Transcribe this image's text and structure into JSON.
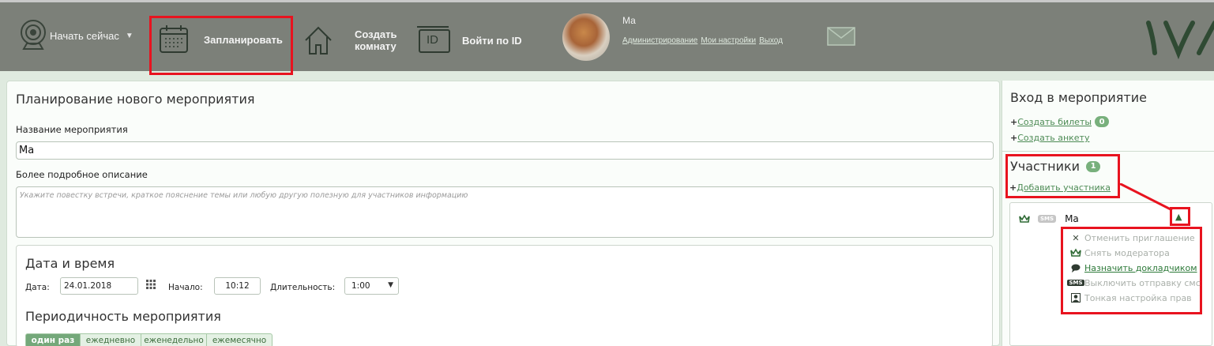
{
  "topbar": {
    "start_now": "Начать сейчас",
    "schedule": "Запланировать",
    "create_room_line1": "Создать",
    "create_room_line2": "комнату",
    "id_icon_text": "ID",
    "login_by_id": "Войти по ID",
    "user_name": "Ма",
    "links": [
      "Администрирование",
      "Мои настройки",
      "Выход"
    ],
    "logo": "IVA"
  },
  "main": {
    "title": "Планирование нового мероприятия",
    "name_label": "Название мероприятия",
    "name_value": "Ма",
    "desc_label": "Более подробное описание",
    "desc_placeholder": "Укажите повестку встречи, краткое пояснение темы или любую другую полезную для участников информацию",
    "datetime_title": "Дата и время",
    "date_label": "Дата:",
    "date_value": "24.01.2018",
    "start_label": "Начало:",
    "start_value": "10:12",
    "duration_label": "Длительность:",
    "duration_value": "1:00",
    "period_title": "Периодичность мероприятия",
    "period_options": [
      "один раз",
      "ежедневно",
      "еженедельно",
      "ежемесячно"
    ]
  },
  "side": {
    "title": "Вход в мероприятие",
    "create_tickets": "Создать билеты",
    "tickets_count": "0",
    "create_form": "Создать анкету",
    "participants_title": "Участники",
    "participants_count": "1",
    "add_participant": "Добавить участника",
    "participant_sms": "SMS",
    "participant_name": "Ма",
    "menu": [
      {
        "label": "Отменить приглашение",
        "icon": "close-icon"
      },
      {
        "label": "Снять модератора",
        "icon": "crown-icon"
      },
      {
        "label": "Назначить докладчиком",
        "icon": "speech-icon"
      },
      {
        "label": "Выключить отправку смс",
        "icon": "sms-icon"
      },
      {
        "label": "Тонкая настройка прав",
        "icon": "user-icon"
      }
    ],
    "menu_icon_sms_text": "SMS"
  },
  "colors": {
    "topbar": "#7c8079",
    "highlight": "#e8131f",
    "accent_green": "#74a87a",
    "page_bg": "#dfeadf"
  }
}
